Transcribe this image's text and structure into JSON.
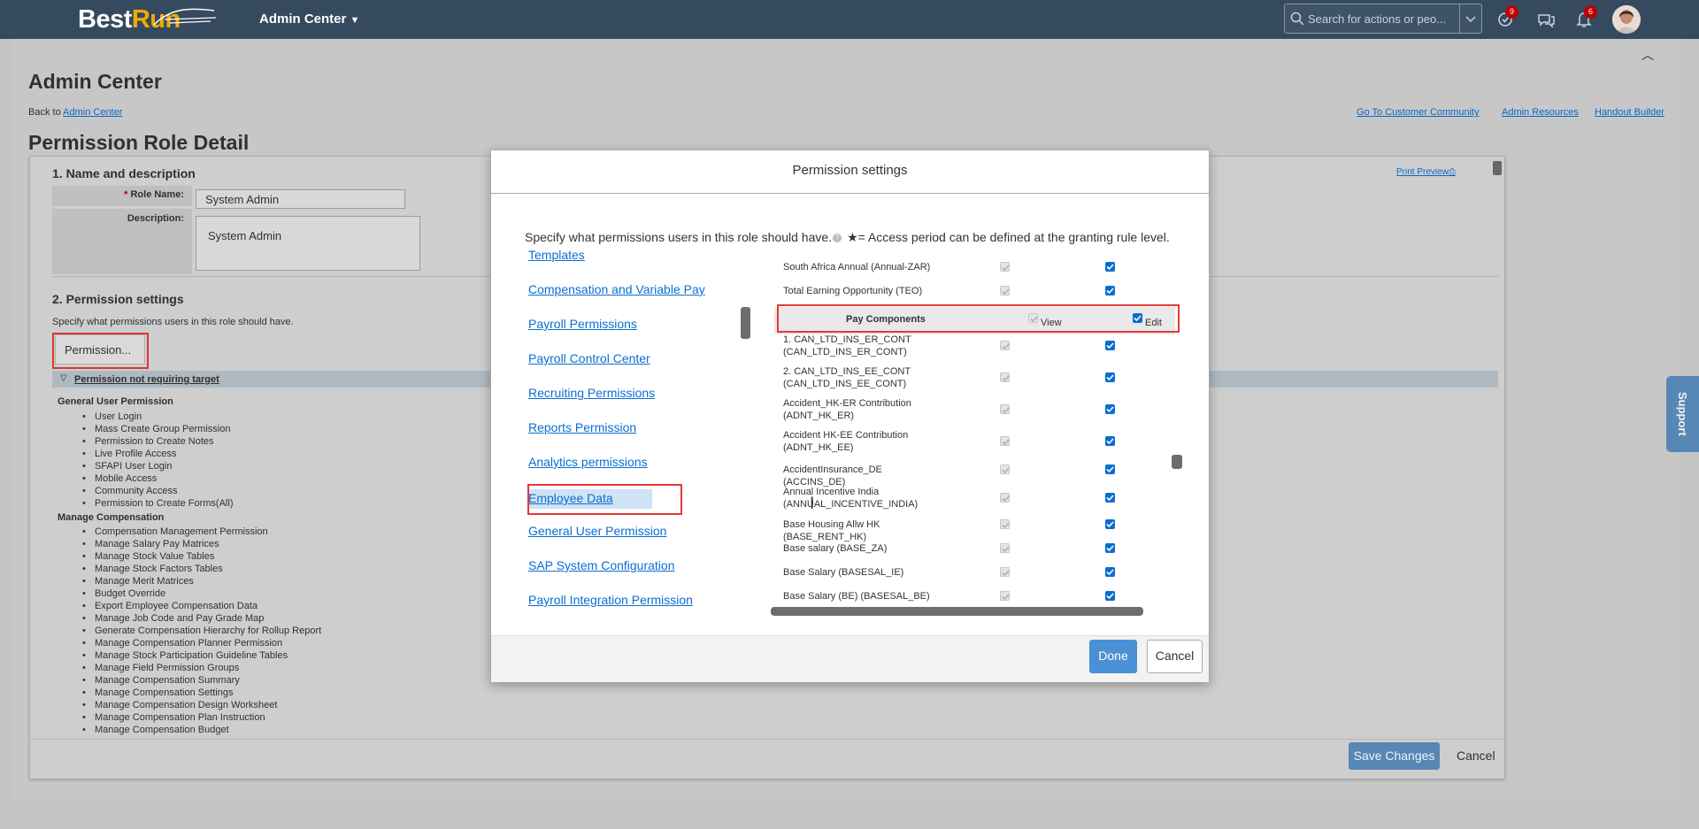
{
  "shell": {
    "logo_best": "Best",
    "logo_run": "Run",
    "admin_menu": "Admin Center",
    "search_placeholder": "Search for actions or peo...",
    "badge_1": "9",
    "badge_2": "6"
  },
  "page": {
    "title": "Admin Center",
    "back_prefix": "Back to",
    "back_link": "Admin Center",
    "links": [
      "Go To Customer Community",
      "Admin Resources",
      "Handout Builder"
    ],
    "role_detail_title": "Permission Role Detail",
    "section1_title": "1. Name and description",
    "print_preview": "Print Preview",
    "role_name_label": "Role Name:",
    "role_name_value": "System Admin",
    "description_label": "Description:",
    "description_value": "System Admin",
    "section2_title": "2. Permission settings",
    "section2_desc": "Specify what permissions users in this role should have.",
    "permission_button": "Permission...",
    "perm_not_requiring_target": "Permission not requiring target",
    "general_user_permission": "General User Permission",
    "general_items": [
      "User Login",
      "Mass Create Group Permission",
      "Permission to Create Notes",
      "Live Profile Access",
      "SFAPI User Login",
      "Mobile Access",
      "Community Access",
      "Permission to Create Forms(All)"
    ],
    "manage_compensation": "Manage Compensation",
    "comp_items": [
      "Compensation Management Permission",
      "Manage Salary Pay Matrices",
      "Manage Stock Value Tables",
      "Manage Stock Factors Tables",
      "Manage Merit Matrices",
      "Budget Override",
      "Export Employee Compensation Data",
      "Manage Job Code and Pay Grade Map",
      "Generate Compensation Hierarchy for Rollup Report",
      "Manage Compensation Planner Permission",
      "Manage Stock Participation Guideline Tables",
      "Manage Field Permission Groups",
      "Manage Compensation Summary",
      "Manage Compensation Settings",
      "Manage Compensation Design Worksheet",
      "Manage Compensation Plan Instruction",
      "Manage Compensation Budget"
    ],
    "save_changes": "Save Changes",
    "cancel": "Cancel",
    "support": "Support"
  },
  "dialog": {
    "title": "Permission settings",
    "desc": "Specify what permissions users in this role should have.",
    "desc_note": "★= Access period can be defined at the granting rule level.",
    "categories": [
      "Templates",
      "Compensation and Variable Pay",
      "Payroll Permissions",
      "Payroll Control Center",
      "Recruiting Permissions",
      "Reports Permission",
      "Analytics permissions",
      "Employee Data",
      "General User Permission",
      "SAP System Configuration",
      "Payroll Integration Permission"
    ],
    "rows_top": [
      "South Africa Annual (Annual-ZAR)",
      "Total Earning Opportunity (TEO)"
    ],
    "group_header": "Pay Components",
    "view_label": "View",
    "edit_label": "Edit",
    "rows": [
      "1. CAN_LTD_INS_ER_CONT (CAN_LTD_INS_ER_CONT)",
      "2. CAN_LTD_INS_EE_CONT (CAN_LTD_INS_EE_CONT)",
      "Accident_HK-ER Contribution (ADNT_HK_ER)",
      "Accident HK-EE Contribution (ADNT_HK_EE)",
      "AccidentInsurance_DE (ACCINS_DE)",
      "Annual Incentive India (ANNUAL_INCENTIVE_INDIA)",
      "Base Housing Allw HK (BASE_RENT_HK)",
      "Base salary (BASE_ZA)",
      "Base Salary (BASESAL_IE)",
      "Base Salary (BE) (BASESAL_BE)"
    ],
    "done": "Done",
    "cancel": "Cancel"
  }
}
